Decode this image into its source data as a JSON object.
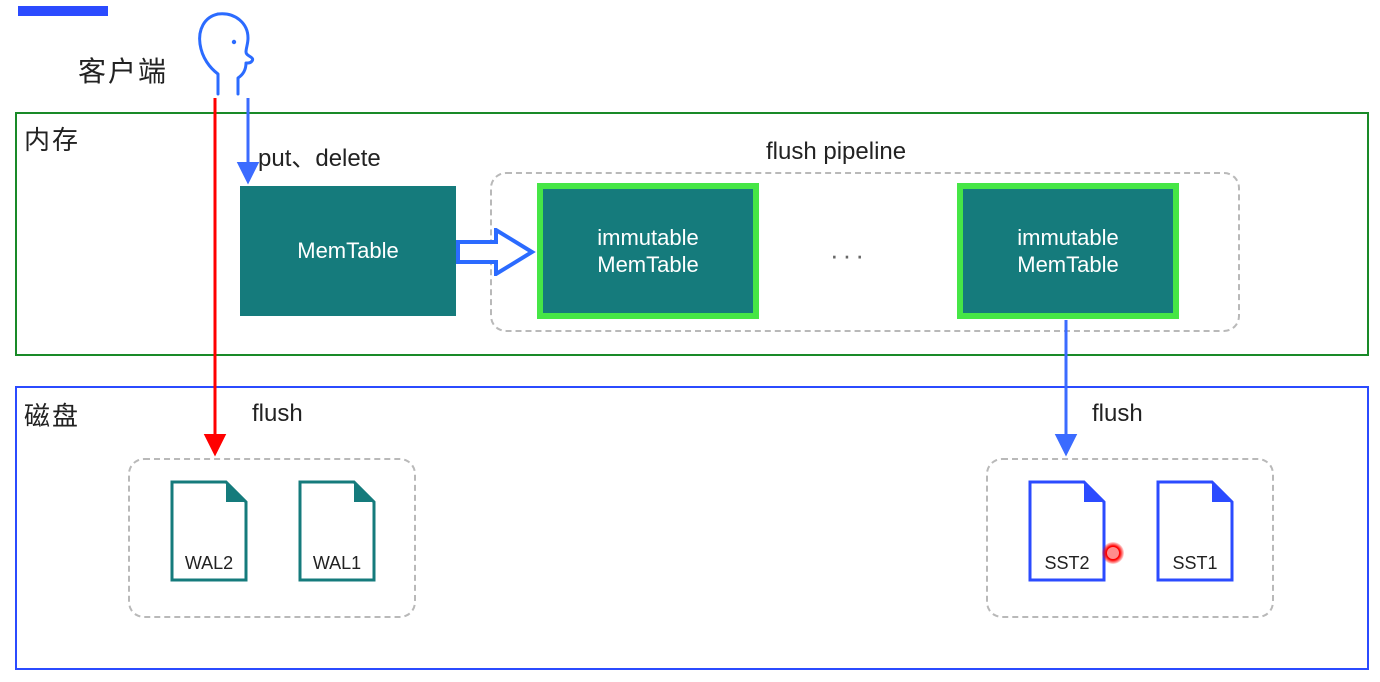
{
  "client_label": "客户端",
  "memory": {
    "label": "内存",
    "put_delete": "put、delete",
    "memtable": "MemTable",
    "flush_pipeline": "flush pipeline",
    "immutable1": "immutable\nMemTable",
    "immutable2": "immutable\nMemTable",
    "ellipsis": "···"
  },
  "disk": {
    "label": "磁盘",
    "flush_left": "flush",
    "flush_right": "flush",
    "wal2": "WAL2",
    "wal1": "WAL1",
    "sst2": "SST2",
    "sst1": "SST1"
  },
  "colors": {
    "blue": "#2b4bff",
    "green_border": "#198a28",
    "teal": "#157b7c",
    "bright_green": "#46e646",
    "red": "#ff0000",
    "gray_dash": "#b9b9b9"
  }
}
